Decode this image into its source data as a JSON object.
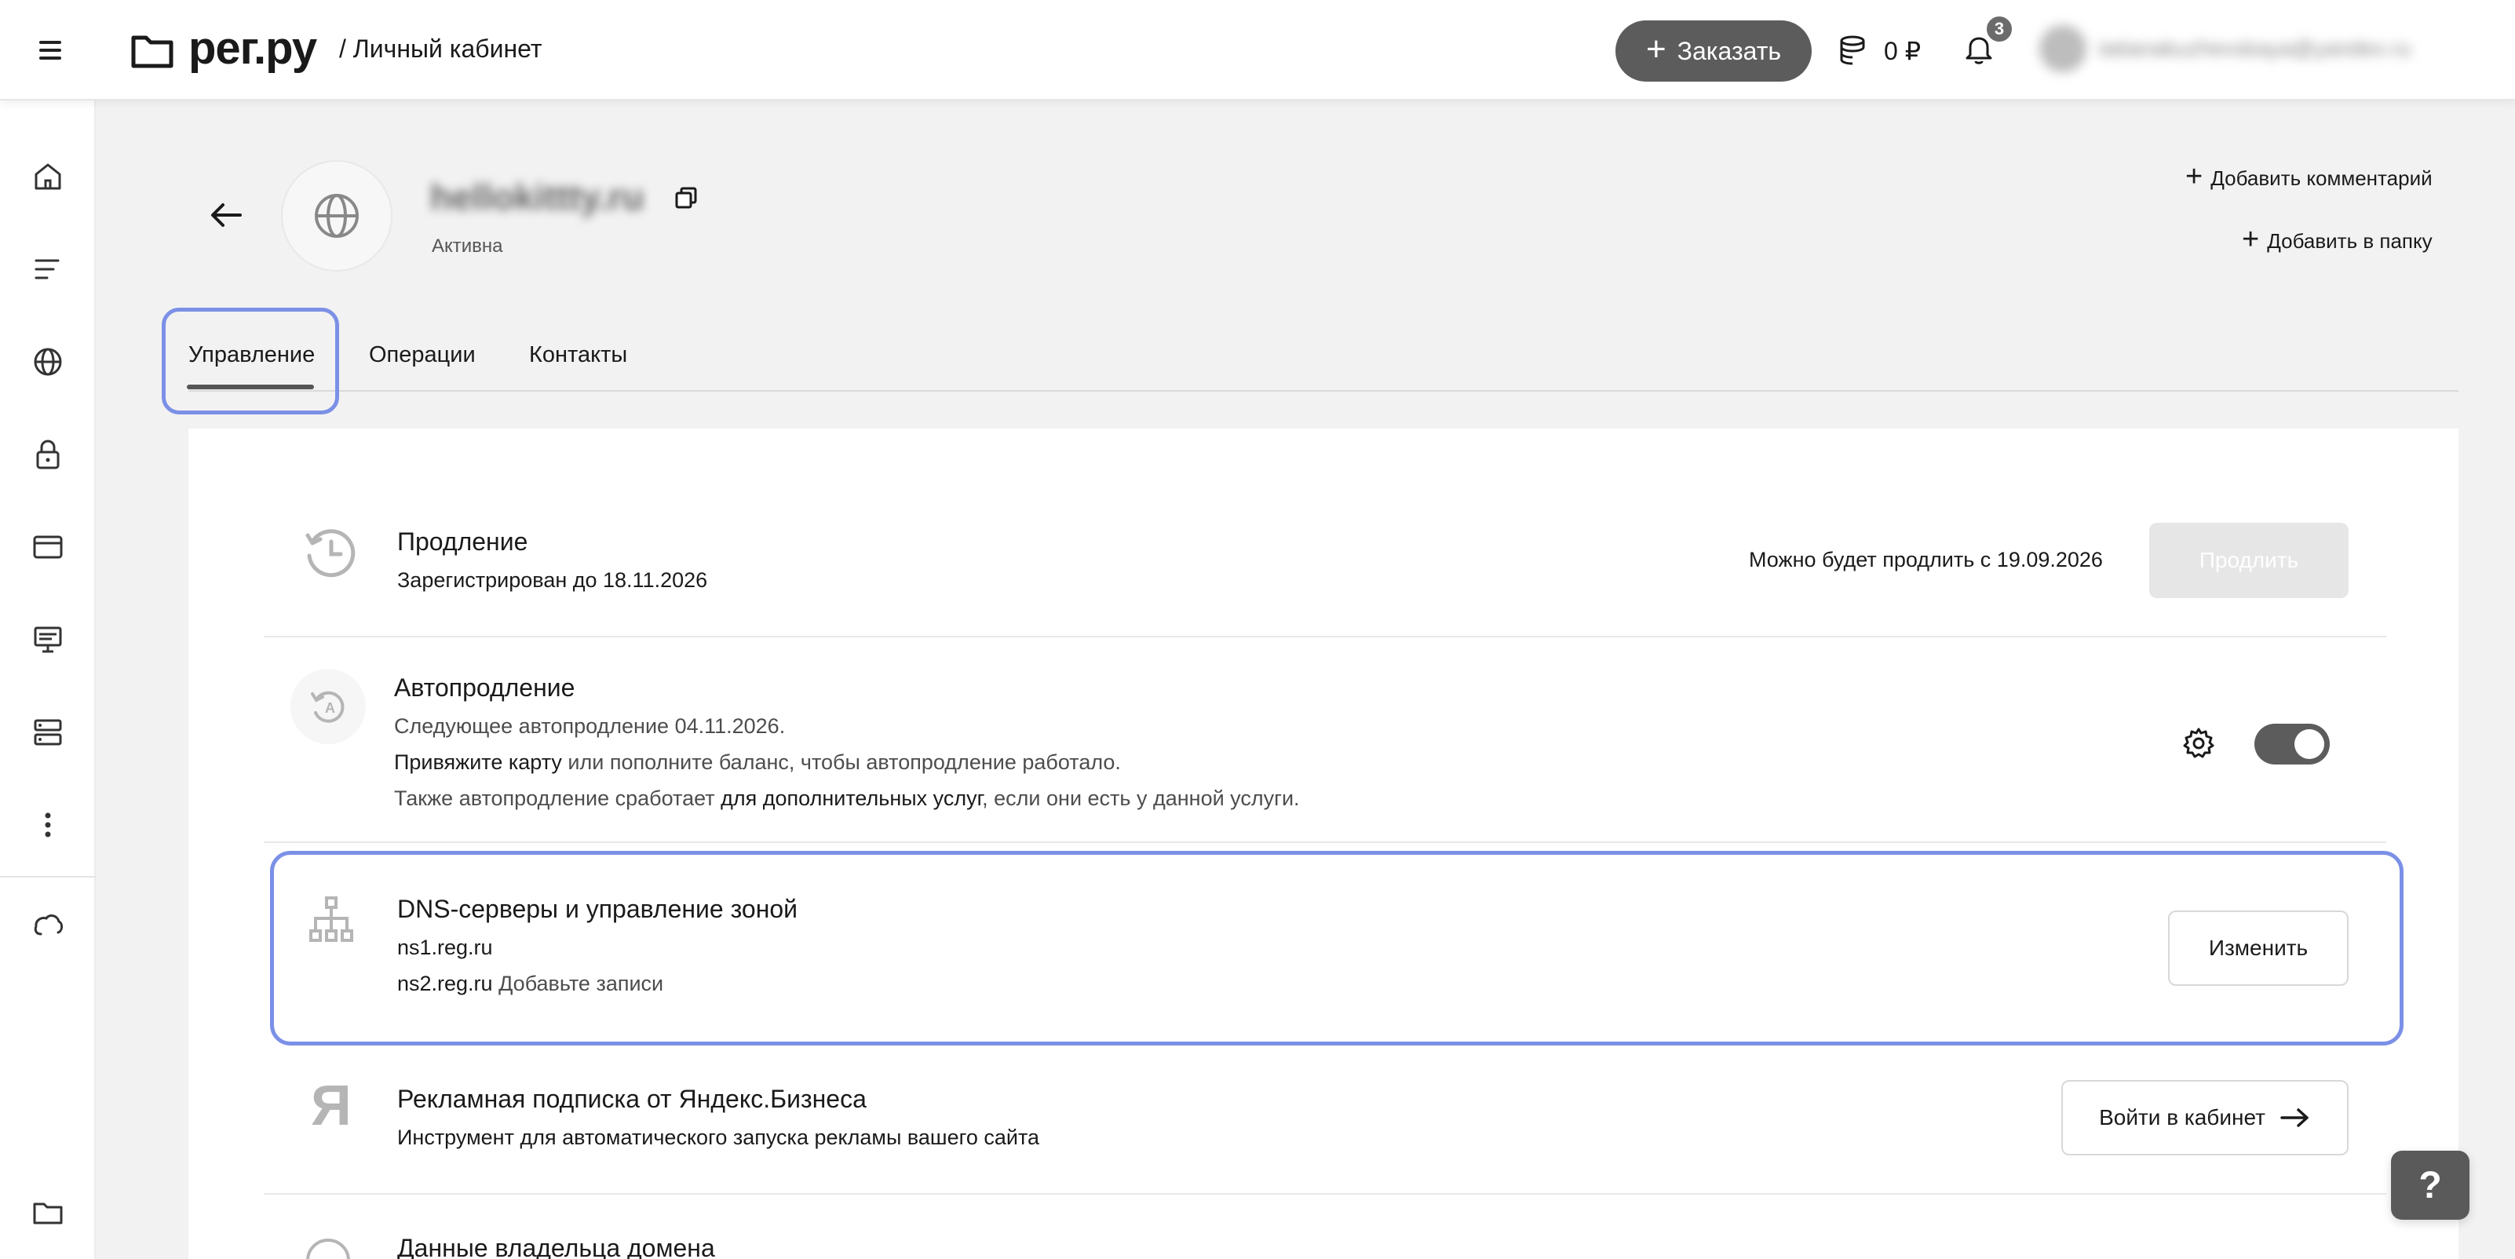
{
  "header": {
    "logo_text": "рег.ру",
    "logo_subtitle": "/ Личный кабинет",
    "order_label": "Заказать",
    "balance": "0 ₽",
    "notifications_count": "3",
    "user_email": "tatianakuzhevskaya@yandex.ru"
  },
  "sidebar": {
    "icons": [
      "home-icon",
      "list-icon",
      "globe-icon",
      "lock-icon",
      "browser-icon",
      "monitor-icon",
      "server-icon",
      "more-icon",
      "cloud-icon",
      "folder-icon"
    ]
  },
  "domain": {
    "name": "hellokittty.ru",
    "status": "Активна",
    "add_comment": "Добавить комментарий",
    "add_to_folder": "Добавить в папку"
  },
  "tabs": [
    {
      "label": "Управление",
      "active": true
    },
    {
      "label": "Операции",
      "active": false
    },
    {
      "label": "Контакты",
      "active": false
    }
  ],
  "renewal": {
    "title": "Продление",
    "subtitle": "Зарегистрирован до 18.11.2026",
    "note": "Можно будет продлить с 19.09.2026",
    "button": "Продлить"
  },
  "autorenew": {
    "title": "Автопродление",
    "line1": "Следующее автопродление 04.11.2026.",
    "line2_link": "Привяжите карту",
    "line2_rest": " или пополните баланс, чтобы автопродление работало.",
    "line3_a": "Также автопродление сработает ",
    "line3_link": "для дополнительных услуг",
    "line3_b": ", если они есть у данной услуги.",
    "enabled": true
  },
  "dns": {
    "title": "DNS-серверы и управление зоной",
    "ns1": "ns1.reg.ru",
    "ns2": "ns2.reg.ru",
    "add_records": "Добавьте записи",
    "button": "Изменить"
  },
  "yandex": {
    "title": "Рекламная подписка от Яндекс.Бизнеса",
    "subtitle": "Инструмент для автоматического запуска рекламы вашего сайта",
    "button": "Войти в кабинет",
    "logo_letter": "Я"
  },
  "owner": {
    "title": "Данные владельца домена"
  },
  "help": {
    "label": "?"
  },
  "colors": {
    "highlight": "#7b90e6",
    "primary_button": "#5c5c5c"
  }
}
